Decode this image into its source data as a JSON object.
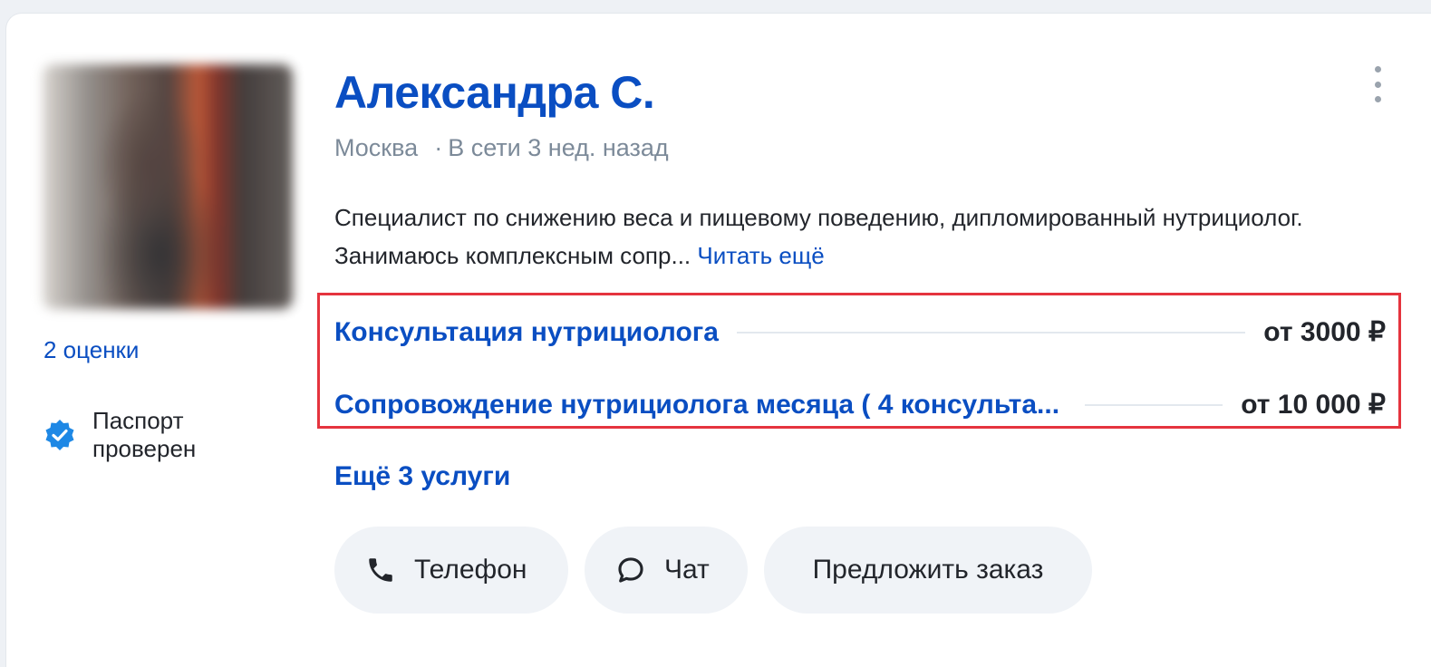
{
  "profile": {
    "name": "Александра С.",
    "city": "Москва",
    "separator": "·",
    "last_seen": "В сети 3 нед. назад",
    "ratings_link": "2 оценки",
    "passport_label": "Паспорт проверен",
    "description": "Специалист по снижению веса и пищевому поведению, дипломированный нутрициолог. Занимаюсь комплексным сопр...",
    "read_more": "Читать ещё"
  },
  "services": [
    {
      "title": "Консультация нутрициолога",
      "price": "от 3000 ₽"
    },
    {
      "title": "Сопровождение нутрициолога месяца ( 4 консульта...",
      "price": "от 10 000 ₽"
    }
  ],
  "more_services": "Ещё 3 услуги",
  "actions": {
    "phone": "Телефон",
    "chat": "Чат",
    "order": "Предложить заказ"
  },
  "colors": {
    "accent": "#0a4ec2",
    "verified": "#1e88e5",
    "highlight_border": "#e5343e"
  },
  "icons": [
    "phone-icon",
    "chat-icon",
    "verified-badge-icon",
    "more-vertical-icon"
  ]
}
